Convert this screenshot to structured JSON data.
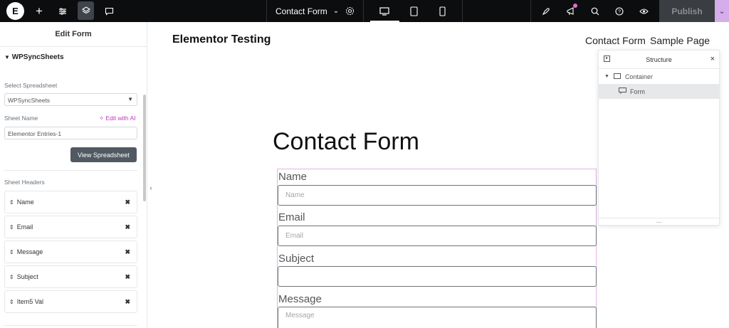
{
  "topbar": {
    "logo": "E",
    "add_icon": "plus-icon",
    "settings_icon": "sliders-icon",
    "structure_icon": "layers-icon",
    "comments_icon": "chat-icon",
    "document_title": "Contact Form",
    "publish_label": "Publish"
  },
  "panel": {
    "title": "Edit Form",
    "section": "WPSyncSheets",
    "select_label": "Select Spreadsheet",
    "select_value": "WPSyncSheets",
    "sheet_name_label": "Sheet Name",
    "edit_ai_label": "Edit with AI",
    "sheet_name_value": "Elementor Entries-1",
    "view_button": "View Spreadsheet",
    "headers_label": "Sheet Headers",
    "headers": [
      "Name",
      "Email",
      "Message",
      "Subject",
      "Item5 Val"
    ]
  },
  "canvas": {
    "site_title": "Elementor Testing",
    "nav": [
      "Contact Form",
      "Sample Page"
    ],
    "heading": "Contact Form",
    "fields": [
      {
        "label": "Name",
        "placeholder": "Name"
      },
      {
        "label": "Email",
        "placeholder": "Email"
      },
      {
        "label": "Subject",
        "placeholder": ""
      },
      {
        "label": "Message",
        "placeholder": "Message"
      }
    ]
  },
  "structure": {
    "title": "Structure",
    "items": [
      "Container",
      "Form"
    ]
  },
  "colors": {
    "topbar_bg": "#0c0d0e",
    "accent_pink": "#c036c0",
    "publish_arrow": "#d5adeb"
  }
}
